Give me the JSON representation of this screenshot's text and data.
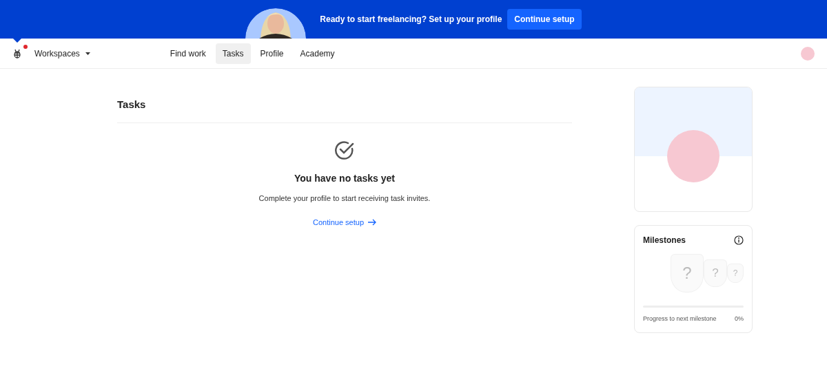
{
  "banner": {
    "text": "Ready to start freelancing? Set up your profile",
    "button": "Continue setup"
  },
  "nav": {
    "has_notification": true,
    "workspaces": "Workspaces",
    "links": [
      {
        "label": "Find work",
        "selected": false
      },
      {
        "label": "Tasks",
        "selected": true
      },
      {
        "label": "Profile",
        "selected": false
      },
      {
        "label": "Academy",
        "selected": false
      }
    ]
  },
  "tasks": {
    "title": "Tasks",
    "empty_title": "You have no tasks yet",
    "empty_text": "Complete your profile to start receiving task invites.",
    "link": "Continue setup"
  },
  "milestones": {
    "title": "Milestones",
    "badges": [
      "?",
      "?",
      "?"
    ],
    "progress_label": "Progress to next milestone",
    "progress_value": "0%",
    "level": 0
  }
}
